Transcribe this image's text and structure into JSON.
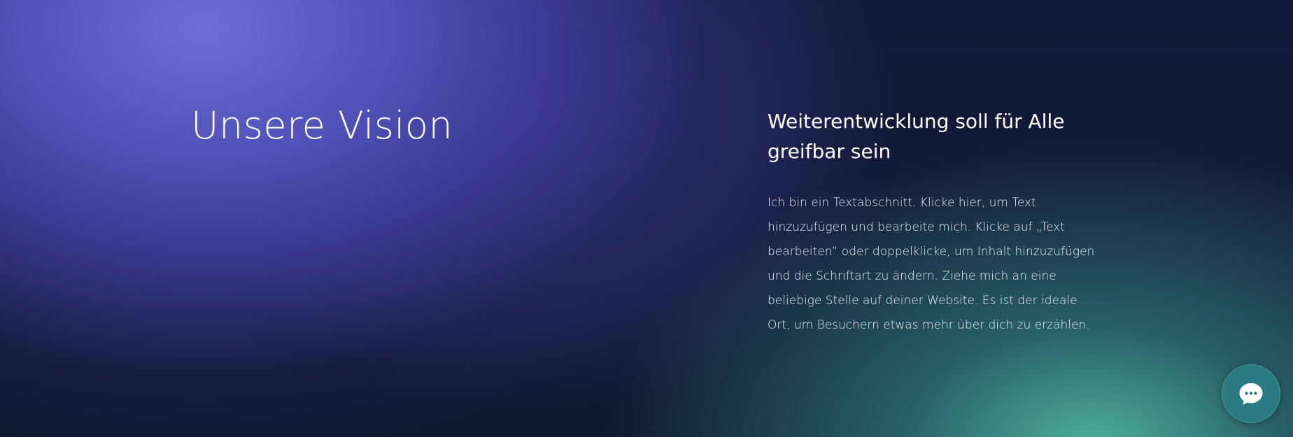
{
  "vision": {
    "title": "Unsere Vision",
    "subheading": "Weiterentwicklung soll für Alle greifbar sein",
    "paragraph": "Ich bin ein Textabschnitt. Klicke hier, um Text hinzuzufügen und bearbeite mich. Klicke auf „Text bearbeiten” oder doppelklicke, um Inhalt hinzuzufügen und die Schriftart zu ändern. Ziehe mich an eine beliebige Stelle auf deiner Website. Es ist der ideale Ort, um Besuchern etwas mehr über dich zu erzählen."
  },
  "chat_widget": {
    "icon": "chat-bubble-icon",
    "color": "#2a7a82"
  },
  "colors": {
    "background_dark": "#0f1830",
    "gradient_purple": "#6c70d6",
    "gradient_teal": "#52b8a4",
    "text": "#ffffff"
  }
}
